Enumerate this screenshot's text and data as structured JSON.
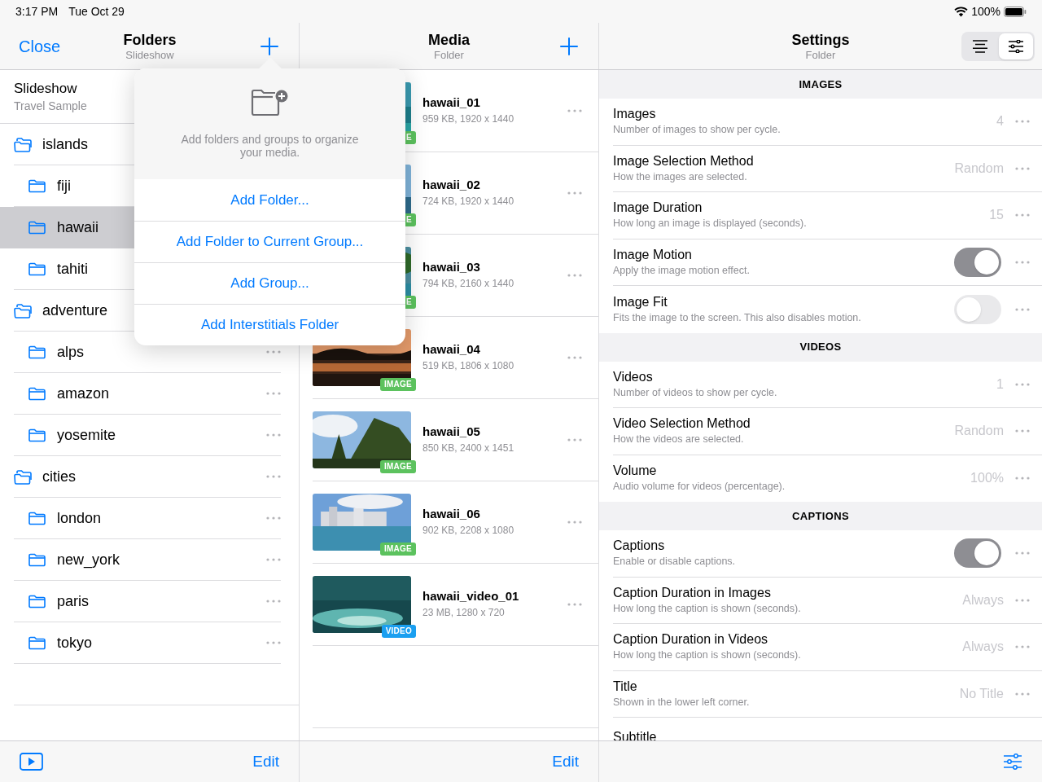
{
  "status_bar": {
    "time": "3:17 PM",
    "date": "Tue Oct 29",
    "battery": "100%"
  },
  "folders": {
    "close": "Close",
    "title": "Folders",
    "subtitle": "Slideshow",
    "header": {
      "title": "Slideshow",
      "subtitle": "Travel Sample"
    },
    "items": [
      {
        "name": "islands",
        "selected": false,
        "more_visible": false,
        "children": [
          {
            "name": "fiji",
            "selected": false,
            "more_visible": false
          },
          {
            "name": "hawaii",
            "selected": true,
            "more_visible": false
          },
          {
            "name": "tahiti",
            "selected": false,
            "more_visible": false
          }
        ]
      },
      {
        "name": "adventure",
        "selected": false,
        "more_visible": false,
        "children": [
          {
            "name": "alps",
            "selected": false,
            "more_visible": true
          },
          {
            "name": "amazon",
            "selected": false,
            "more_visible": true
          },
          {
            "name": "yosemite",
            "selected": false,
            "more_visible": true
          }
        ]
      },
      {
        "name": "cities",
        "selected": false,
        "more_visible": true,
        "children": [
          {
            "name": "london",
            "selected": false,
            "more_visible": true
          },
          {
            "name": "new_york",
            "selected": false,
            "more_visible": true
          },
          {
            "name": "paris",
            "selected": false,
            "more_visible": true
          },
          {
            "name": "tokyo",
            "selected": false,
            "more_visible": true
          }
        ]
      }
    ],
    "edit": "Edit"
  },
  "popover": {
    "message": "Add folders and groups to organize your media.",
    "actions": [
      "Add Folder...",
      "Add Folder to Current Group...",
      "Add Group...",
      "Add Interstitials Folder"
    ]
  },
  "media": {
    "title": "Media",
    "subtitle": "Folder",
    "edit": "Edit",
    "items": [
      {
        "name": "hawaii_01",
        "info": "959 KB, 1920 x 1440",
        "badge": "E"
      },
      {
        "name": "hawaii_02",
        "info": "724 KB, 1920 x 1440",
        "badge": "E"
      },
      {
        "name": "hawaii_03",
        "info": "794 KB, 2160 x 1440",
        "badge": "E"
      },
      {
        "name": "hawaii_04",
        "info": "519 KB, 1806 x 1080",
        "badge": "IMAGE"
      },
      {
        "name": "hawaii_05",
        "info": "850 KB, 2400 x 1451",
        "badge": "IMAGE"
      },
      {
        "name": "hawaii_06",
        "info": "902 KB, 2208 x 1080",
        "badge": "IMAGE"
      },
      {
        "name": "hawaii_video_01",
        "info": "23 MB, 1280 x 720",
        "badge": "VIDEO",
        "kind": "video"
      }
    ]
  },
  "settings": {
    "title": "Settings",
    "subtitle": "Folder",
    "segments": [
      {
        "selected": false
      },
      {
        "selected": true
      }
    ],
    "sections": [
      {
        "header": "IMAGES",
        "rows": [
          {
            "kind": "value",
            "title": "Images",
            "description": "Number of images to show per cycle.",
            "value": "4"
          },
          {
            "kind": "value",
            "title": "Image Selection Method",
            "description": "How the images are selected.",
            "value": "Random"
          },
          {
            "kind": "value",
            "title": "Image Duration",
            "description": "How long an image is displayed (seconds).",
            "value": "15"
          },
          {
            "kind": "toggle",
            "title": "Image Motion",
            "description": "Apply the image motion effect.",
            "on": true
          },
          {
            "kind": "toggle",
            "title": "Image Fit",
            "description": "Fits the image to the screen. This also disables motion.",
            "on": false
          }
        ]
      },
      {
        "header": "VIDEOS",
        "rows": [
          {
            "kind": "value",
            "title": "Videos",
            "description": "Number of videos to show per cycle.",
            "value": "1"
          },
          {
            "kind": "value",
            "title": "Video Selection Method",
            "description": "How the videos are selected.",
            "value": "Random"
          },
          {
            "kind": "value",
            "title": "Volume",
            "description": "Audio volume for videos (percentage).",
            "value": "100%"
          }
        ]
      },
      {
        "header": "CAPTIONS",
        "rows": [
          {
            "kind": "toggle",
            "title": "Captions",
            "description": "Enable or disable captions.",
            "on": true
          },
          {
            "kind": "value",
            "title": "Caption Duration in Images",
            "description": "How long the caption is shown (seconds).",
            "value": "Always"
          },
          {
            "kind": "value",
            "title": "Caption Duration in Videos",
            "description": "How long the caption is shown (seconds).",
            "value": "Always"
          },
          {
            "kind": "value",
            "title": "Title",
            "description": "Shown in the lower left corner.",
            "value": "No Title"
          },
          {
            "kind": "cut",
            "title": "Subtitle"
          }
        ]
      }
    ]
  }
}
